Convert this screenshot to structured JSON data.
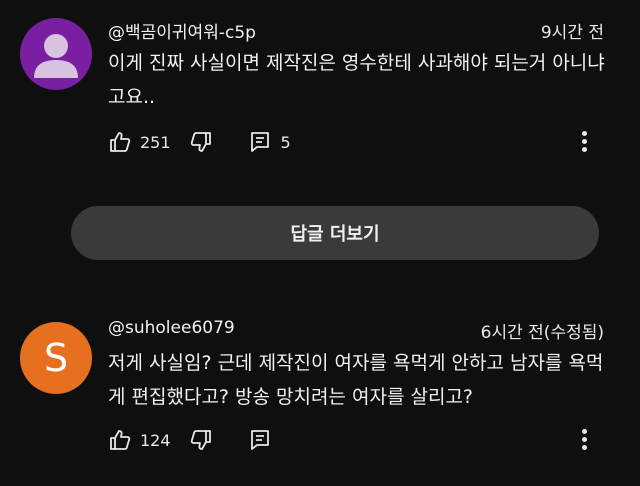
{
  "comments": [
    {
      "handle": "@백곰이귀여워-c5p",
      "time": "9시간 전",
      "text": "이게 진짜 사실이면 제작진은 영수한테 사과해야 되는거 아니냐고요..",
      "likes": "251",
      "replies": "5",
      "avatar_color": "#7b1fa2",
      "avatar_icon": "default-user-silhouette"
    },
    {
      "handle": "@suholee6079",
      "time": "6시간 전(수정됨)",
      "text": "저게 사실임? 근데 제작진이 여자를 욕먹게 안하고 남자를 욕먹게 편집했다고? 방송 망치려는 여자를 살리고?",
      "likes": "124",
      "avatar_letter": "S",
      "avatar_color": "#e6701f"
    }
  ],
  "more_replies_label": "답글 더보기",
  "icons": [
    "thumbs-up-icon",
    "thumbs-down-icon",
    "reply-icon",
    "more-vert-icon"
  ]
}
